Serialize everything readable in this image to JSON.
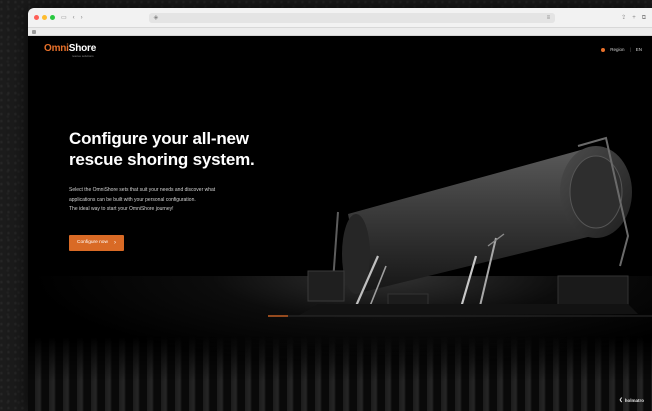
{
  "browser": {
    "traffic_colors": [
      "#ff5f57",
      "#febc2e",
      "#28c840"
    ],
    "icons": [
      "sidebar-icon",
      "back-icon",
      "forward-icon",
      "shield-icon",
      "reader-icon",
      "share-icon",
      "new-tab-icon",
      "tabs-icon"
    ]
  },
  "header": {
    "logo_part1": "Omni",
    "logo_part2": "Shore",
    "logo_tagline": "rescue solutions",
    "nav_region": "Region",
    "nav_lang": "EN"
  },
  "hero": {
    "headline_line1": "Configure your all-new",
    "headline_line2": "rescue shoring system.",
    "body_line1": "Select the OmniShore sets that suit your needs and discover what",
    "body_line2": "applications can be built with your personal configuration.",
    "body_line3": "The ideal way to start your OmniShore journey!",
    "cta_label": "Configure now",
    "cta_chevron": "›"
  },
  "footer": {
    "brand": "holmatro"
  },
  "colors": {
    "accent": "#e8702a",
    "cta": "#d96a25",
    "background": "#000000"
  }
}
